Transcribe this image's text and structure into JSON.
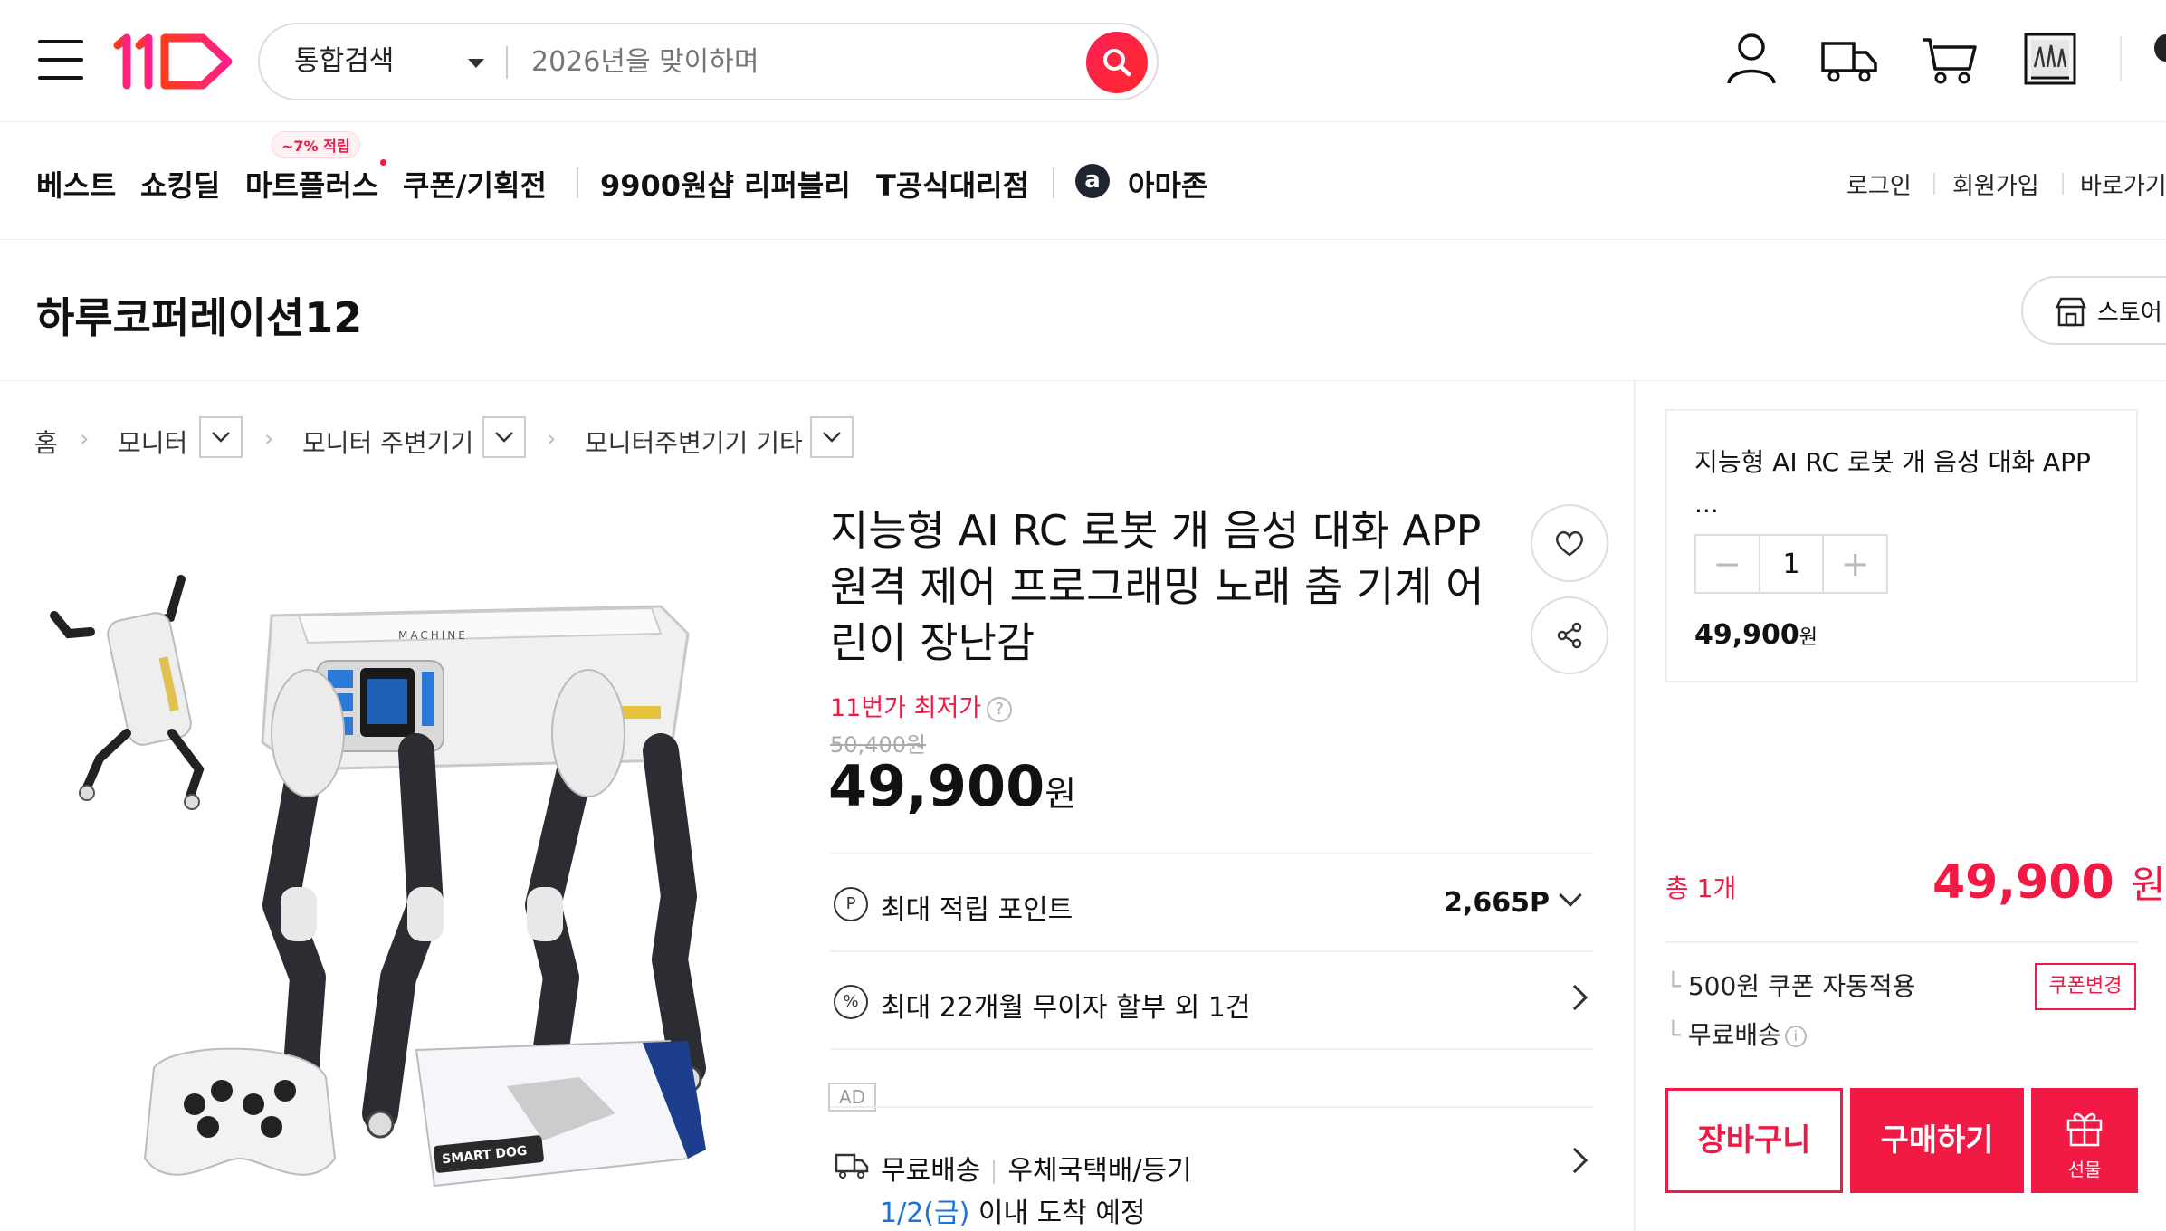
{
  "header": {
    "search_category": "통합검색",
    "search_placeholder": "2026년을 맞이하며"
  },
  "nav": {
    "items": [
      "베스트",
      "쇼킹딜",
      "마트플러스",
      "쿠폰/기획전",
      "9900원샵",
      "리퍼블리",
      "T공식대리점",
      "아마존"
    ],
    "badge": "~7% 적립",
    "amazon_letter": "a",
    "util": [
      "로그인",
      "회원가입",
      "바로가기"
    ]
  },
  "store": {
    "name": "하루코퍼레이션12",
    "button": "스토어"
  },
  "breadcrumb": [
    "홈",
    "모니터",
    "모니터 주변기기",
    "모니터주변기기 기타"
  ],
  "product": {
    "title": "지능형 AI RC 로봇 개 음성 대화 APP 원격 제어 프로그래밍 노래 춤 기계 어린이 장난감",
    "best_price_label": "11번가 최저가",
    "help_mark": "?",
    "original_price": "50,400원",
    "price": "49,900",
    "won": "원",
    "points_label": "최대 적립 포인트",
    "points_icon": "P",
    "points_value": "2,665P",
    "installment_label": "최대 22개월 무이자 할부 외 1건",
    "installment_icon": "%",
    "ad": "AD",
    "shipping_free": "무료배송",
    "shipping_method": "우체국택배/등기",
    "arrival_date": "1/2(금)",
    "arrival_text": "이내 도착 예정"
  },
  "side": {
    "title": "지능형 AI RC 로봇 개 음성 대화 APP",
    "title_more": "...",
    "qty": "1",
    "minus": "−",
    "plus": "+",
    "price": "49,900",
    "won": "원",
    "total_label": "총 1개",
    "total_price": "49,900",
    "total_won": "원",
    "coupon_text": "500원 쿠폰 자동적용",
    "coupon_button": "쿠폰변경",
    "free_shipping": "무료배송",
    "info_mark": "i",
    "cart_button": "장바구니",
    "buy_button": "구매하기",
    "gift_button": "선물",
    "tree_mark": "└"
  },
  "image": {
    "box_text": "SMART DOG",
    "robot_text": "MACHINE"
  },
  "colors": {
    "accent": "#f01a45",
    "link_blue": "#1a73d9"
  }
}
